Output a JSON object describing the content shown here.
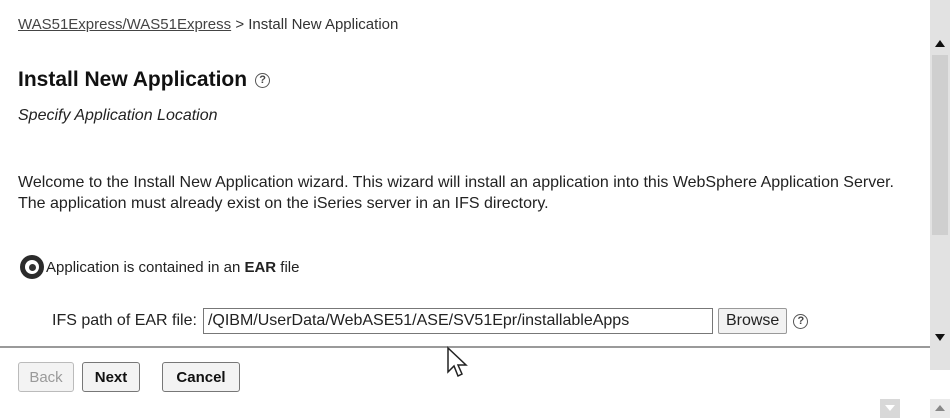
{
  "breadcrumb": {
    "link": "WAS51Express/WAS51Express",
    "separator": ">",
    "current": "Install New Application"
  },
  "page": {
    "title": "Install New Application",
    "subtitle": "Specify Application Location",
    "welcome_text": "Welcome to the Install New Application wizard. This wizard will install an application into this WebSphere Application Server. The application must already exist on the iSeries server in an IFS directory."
  },
  "option": {
    "label_prefix": "Application is contained in an ",
    "label_bold": "EAR",
    "label_suffix": " file",
    "selected": true
  },
  "path_field": {
    "label": "IFS path of EAR file:",
    "value": "/QIBM/UserData/WebASE51/ASE/SV51Epr/installableApps"
  },
  "buttons": {
    "browse": "Browse",
    "back": "Back",
    "next": "Next",
    "cancel": "Cancel"
  },
  "icons": {
    "help": "?"
  },
  "colors": {
    "divider": "#9a9a9a",
    "disabled_text": "#9a9a9a"
  }
}
